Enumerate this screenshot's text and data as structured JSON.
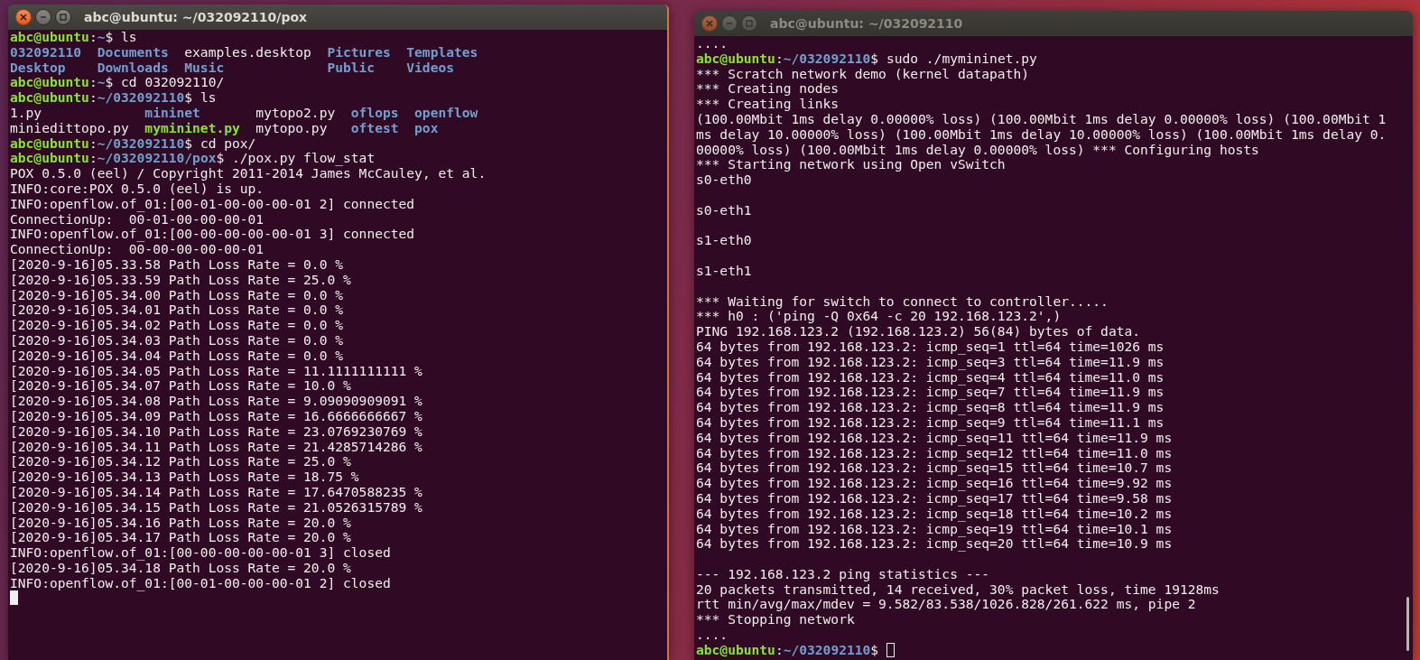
{
  "windows": [
    {
      "title": "abc@ubuntu: ~/032092110/pox",
      "focused": true,
      "scrollbar": false,
      "lines": [
        {
          "kind": "segments",
          "segments": [
            {
              "kind": "user",
              "text": "abc@ubuntu"
            },
            {
              "kind": "plain",
              "text": ":"
            },
            {
              "kind": "path",
              "text": "~"
            },
            {
              "kind": "plain",
              "text": "$ ls"
            }
          ]
        },
        {
          "kind": "listing",
          "columns": [
            [
              {
                "name": "032092110",
                "kind": "dir"
              },
              {
                "name": "Desktop",
                "kind": "dir"
              }
            ],
            [
              {
                "name": "Documents",
                "kind": "dir"
              },
              {
                "name": "Downloads",
                "kind": "dir"
              }
            ],
            [
              {
                "name": "examples.desktop",
                "kind": "file"
              },
              {
                "name": "Music",
                "kind": "dir"
              }
            ],
            [
              {
                "name": "Pictures",
                "kind": "dir"
              },
              {
                "name": "Public",
                "kind": "dir"
              }
            ],
            [
              {
                "name": "Templates",
                "kind": "dir"
              },
              {
                "name": "Videos",
                "kind": "dir"
              }
            ]
          ]
        },
        {
          "kind": "segments",
          "segments": [
            {
              "kind": "user",
              "text": "abc@ubuntu"
            },
            {
              "kind": "plain",
              "text": ":"
            },
            {
              "kind": "path",
              "text": "~"
            },
            {
              "kind": "plain",
              "text": "$ cd 032092110/"
            }
          ]
        },
        {
          "kind": "segments",
          "segments": [
            {
              "kind": "user",
              "text": "abc@ubuntu"
            },
            {
              "kind": "plain",
              "text": ":"
            },
            {
              "kind": "path",
              "text": "~/032092110"
            },
            {
              "kind": "plain",
              "text": "$ ls"
            }
          ]
        },
        {
          "kind": "listing",
          "columns": [
            [
              {
                "name": "1.py",
                "kind": "file"
              },
              {
                "name": "miniedittopo.py",
                "kind": "file"
              }
            ],
            [
              {
                "name": "mininet",
                "kind": "dir"
              },
              {
                "name": "mymininet.py",
                "kind": "exec"
              }
            ],
            [
              {
                "name": "mytopo2.py",
                "kind": "file"
              },
              {
                "name": "mytopo.py",
                "kind": "file"
              }
            ],
            [
              {
                "name": "oflops",
                "kind": "dir"
              },
              {
                "name": "oftest",
                "kind": "dir"
              }
            ],
            [
              {
                "name": "openflow",
                "kind": "dir"
              },
              {
                "name": "pox",
                "kind": "dir"
              }
            ]
          ]
        },
        {
          "kind": "segments",
          "segments": [
            {
              "kind": "user",
              "text": "abc@ubuntu"
            },
            {
              "kind": "plain",
              "text": ":"
            },
            {
              "kind": "path",
              "text": "~/032092110"
            },
            {
              "kind": "plain",
              "text": "$ cd pox/"
            }
          ]
        },
        {
          "kind": "segments",
          "segments": [
            {
              "kind": "user",
              "text": "abc@ubuntu"
            },
            {
              "kind": "plain",
              "text": ":"
            },
            {
              "kind": "path",
              "text": "~/032092110/pox"
            },
            {
              "kind": "plain",
              "text": "$ ./pox.py flow_stat"
            }
          ]
        },
        {
          "kind": "text",
          "text": "POX 0.5.0 (eel) / Copyright 2011-2014 James McCauley, et al."
        },
        {
          "kind": "text",
          "text": "INFO:core:POX 0.5.0 (eel) is up."
        },
        {
          "kind": "text",
          "text": "INFO:openflow.of_01:[00-01-00-00-00-01 2] connected"
        },
        {
          "kind": "text",
          "text": "ConnectionUp:  00-01-00-00-00-01"
        },
        {
          "kind": "text",
          "text": "INFO:openflow.of_01:[00-00-00-00-00-01 3] connected"
        },
        {
          "kind": "text",
          "text": "ConnectionUp:  00-00-00-00-00-01"
        },
        {
          "kind": "text",
          "text": "[2020-9-16]05.33.58 Path Loss Rate = 0.0 %"
        },
        {
          "kind": "text",
          "text": "[2020-9-16]05.33.59 Path Loss Rate = 25.0 %"
        },
        {
          "kind": "text",
          "text": "[2020-9-16]05.34.00 Path Loss Rate = 0.0 %"
        },
        {
          "kind": "text",
          "text": "[2020-9-16]05.34.01 Path Loss Rate = 0.0 %"
        },
        {
          "kind": "text",
          "text": "[2020-9-16]05.34.02 Path Loss Rate = 0.0 %"
        },
        {
          "kind": "text",
          "text": "[2020-9-16]05.34.03 Path Loss Rate = 0.0 %"
        },
        {
          "kind": "text",
          "text": "[2020-9-16]05.34.04 Path Loss Rate = 0.0 %"
        },
        {
          "kind": "text",
          "text": "[2020-9-16]05.34.05 Path Loss Rate = 11.1111111111 %"
        },
        {
          "kind": "text",
          "text": "[2020-9-16]05.34.07 Path Loss Rate = 10.0 %"
        },
        {
          "kind": "text",
          "text": "[2020-9-16]05.34.08 Path Loss Rate = 9.09090909091 %"
        },
        {
          "kind": "text",
          "text": "[2020-9-16]05.34.09 Path Loss Rate = 16.6666666667 %"
        },
        {
          "kind": "text",
          "text": "[2020-9-16]05.34.10 Path Loss Rate = 23.0769230769 %"
        },
        {
          "kind": "text",
          "text": "[2020-9-16]05.34.11 Path Loss Rate = 21.4285714286 %"
        },
        {
          "kind": "text",
          "text": "[2020-9-16]05.34.12 Path Loss Rate = 25.0 %"
        },
        {
          "kind": "text",
          "text": "[2020-9-16]05.34.13 Path Loss Rate = 18.75 %"
        },
        {
          "kind": "text",
          "text": "[2020-9-16]05.34.14 Path Loss Rate = 17.6470588235 %"
        },
        {
          "kind": "text",
          "text": "[2020-9-16]05.34.15 Path Loss Rate = 21.0526315789 %"
        },
        {
          "kind": "text",
          "text": "[2020-9-16]05.34.16 Path Loss Rate = 20.0 %"
        },
        {
          "kind": "text",
          "text": "[2020-9-16]05.34.17 Path Loss Rate = 20.0 %"
        },
        {
          "kind": "text",
          "text": "INFO:openflow.of_01:[00-00-00-00-00-01 3] closed"
        },
        {
          "kind": "text",
          "text": "[2020-9-16]05.34.18 Path Loss Rate = 20.0 %"
        },
        {
          "kind": "text",
          "text": "INFO:openflow.of_01:[00-01-00-00-00-01 2] closed"
        },
        {
          "kind": "cursor"
        }
      ]
    },
    {
      "title": "abc@ubuntu: ~/032092110",
      "focused": false,
      "scrollbar": true,
      "lines": [
        {
          "kind": "text",
          "text": "...."
        },
        {
          "kind": "segments",
          "segments": [
            {
              "kind": "user",
              "text": "abc@ubuntu"
            },
            {
              "kind": "plain",
              "text": ":"
            },
            {
              "kind": "path",
              "text": "~/032092110"
            },
            {
              "kind": "plain",
              "text": "$ sudo ./mymininet.py"
            }
          ]
        },
        {
          "kind": "text",
          "text": "*** Scratch network demo (kernel datapath)"
        },
        {
          "kind": "text",
          "text": "*** Creating nodes"
        },
        {
          "kind": "text",
          "text": "*** Creating links"
        },
        {
          "kind": "text",
          "text": "(100.00Mbit 1ms delay 0.00000% loss) (100.00Mbit 1ms delay 0.00000% loss) (100.00Mbit 1"
        },
        {
          "kind": "text",
          "text": "ms delay 10.00000% loss) (100.00Mbit 1ms delay 10.00000% loss) (100.00Mbit 1ms delay 0."
        },
        {
          "kind": "text",
          "text": "00000% loss) (100.00Mbit 1ms delay 0.00000% loss) *** Configuring hosts"
        },
        {
          "kind": "text",
          "text": "*** Starting network using Open vSwitch"
        },
        {
          "kind": "text",
          "text": "s0-eth0"
        },
        {
          "kind": "blank"
        },
        {
          "kind": "text",
          "text": "s0-eth1"
        },
        {
          "kind": "blank"
        },
        {
          "kind": "text",
          "text": "s1-eth0"
        },
        {
          "kind": "blank"
        },
        {
          "kind": "text",
          "text": "s1-eth1"
        },
        {
          "kind": "blank"
        },
        {
          "kind": "text",
          "text": "*** Waiting for switch to connect to controller....."
        },
        {
          "kind": "text",
          "text": "*** h0 : ('ping -Q 0x64 -c 20 192.168.123.2',)"
        },
        {
          "kind": "text",
          "text": "PING 192.168.123.2 (192.168.123.2) 56(84) bytes of data."
        },
        {
          "kind": "text",
          "text": "64 bytes from 192.168.123.2: icmp_seq=1 ttl=64 time=1026 ms"
        },
        {
          "kind": "text",
          "text": "64 bytes from 192.168.123.2: icmp_seq=3 ttl=64 time=11.9 ms"
        },
        {
          "kind": "text",
          "text": "64 bytes from 192.168.123.2: icmp_seq=4 ttl=64 time=11.0 ms"
        },
        {
          "kind": "text",
          "text": "64 bytes from 192.168.123.2: icmp_seq=7 ttl=64 time=11.9 ms"
        },
        {
          "kind": "text",
          "text": "64 bytes from 192.168.123.2: icmp_seq=8 ttl=64 time=11.9 ms"
        },
        {
          "kind": "text",
          "text": "64 bytes from 192.168.123.2: icmp_seq=9 ttl=64 time=11.1 ms"
        },
        {
          "kind": "text",
          "text": "64 bytes from 192.168.123.2: icmp_seq=11 ttl=64 time=11.9 ms"
        },
        {
          "kind": "text",
          "text": "64 bytes from 192.168.123.2: icmp_seq=12 ttl=64 time=11.0 ms"
        },
        {
          "kind": "text",
          "text": "64 bytes from 192.168.123.2: icmp_seq=15 ttl=64 time=10.7 ms"
        },
        {
          "kind": "text",
          "text": "64 bytes from 192.168.123.2: icmp_seq=16 ttl=64 time=9.92 ms"
        },
        {
          "kind": "text",
          "text": "64 bytes from 192.168.123.2: icmp_seq=17 ttl=64 time=9.58 ms"
        },
        {
          "kind": "text",
          "text": "64 bytes from 192.168.123.2: icmp_seq=18 ttl=64 time=10.2 ms"
        },
        {
          "kind": "text",
          "text": "64 bytes from 192.168.123.2: icmp_seq=19 ttl=64 time=10.1 ms"
        },
        {
          "kind": "text",
          "text": "64 bytes from 192.168.123.2: icmp_seq=20 ttl=64 time=10.9 ms"
        },
        {
          "kind": "blank"
        },
        {
          "kind": "text",
          "text": "--- 192.168.123.2 ping statistics ---"
        },
        {
          "kind": "text",
          "text": "20 packets transmitted, 14 received, 30% packet loss, time 19128ms"
        },
        {
          "kind": "text",
          "text": "rtt min/avg/max/mdev = 9.582/83.538/1026.828/261.622 ms, pipe 2"
        },
        {
          "kind": "text",
          "text": "*** Stopping network"
        },
        {
          "kind": "text",
          "text": "...."
        },
        {
          "kind": "segments",
          "cursor": true,
          "segments": [
            {
              "kind": "user",
              "text": "abc@ubuntu"
            },
            {
              "kind": "plain",
              "text": ":"
            },
            {
              "kind": "path",
              "text": "~/032092110"
            },
            {
              "kind": "plain",
              "text": "$ "
            }
          ]
        }
      ]
    }
  ]
}
